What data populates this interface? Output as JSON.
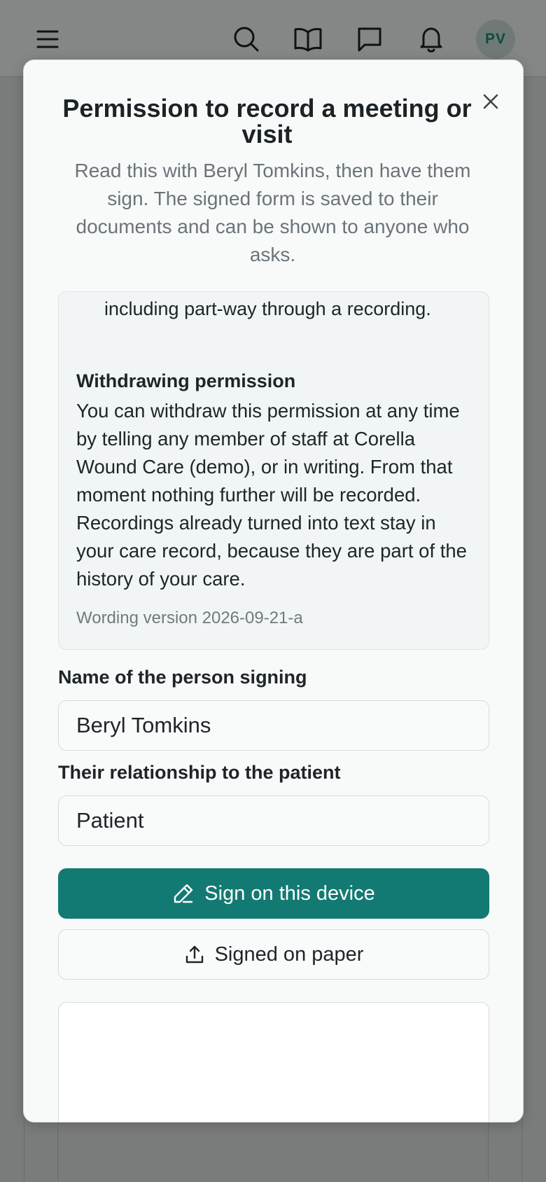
{
  "header": {
    "menu_icon": "menu-icon",
    "search_icon": "search-icon",
    "book_icon": "book-icon",
    "chat_icon": "chat-icon",
    "bell_icon": "bell-icon",
    "avatar_initials": "PV"
  },
  "modal": {
    "title": "Permission to record a meeting or visit",
    "subtitle": "Read this with Beryl Tomkins, then have them sign. The signed form is saved to their documents and can be shown to anyone who asks.",
    "consent": {
      "continued_text": "including part-way through a recording.",
      "section_title": "Withdrawing permission",
      "section_body": "You can withdraw this permission at any time by telling any member of staff at Corella Wound Care (demo), or in writing. From that moment nothing further will be recorded. Recordings already turned into text stay in your care record, because they are part of the history of your care.",
      "version": "Wording version 2026-09-21-a"
    },
    "signer_name_label": "Name of the person signing",
    "signer_name_value": "Beryl Tomkins",
    "relationship_label": "Their relationship to the patient",
    "relationship_value": "Patient",
    "sign_device_label": "Sign on this device",
    "signed_paper_label": "Signed on paper"
  },
  "colors": {
    "primary": "#137a73",
    "overlay": "#7a7b7b",
    "modal_bg": "#f8fafa"
  }
}
